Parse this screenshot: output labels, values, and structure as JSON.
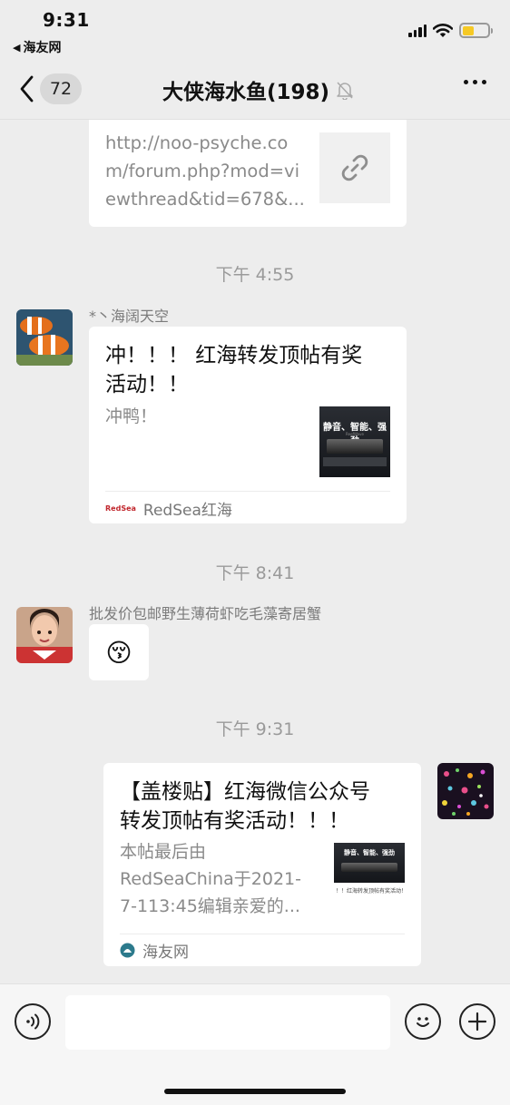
{
  "status_bar": {
    "time": "9:31",
    "back_app": "海友网"
  },
  "nav": {
    "unread_count": "72",
    "title": "大侠海水鱼(198)"
  },
  "messages": {
    "link_card": {
      "url_lines": [
        "http://noo-psyche.co",
        "m/forum.php?mod=vi",
        "ewthread&tid=678&..."
      ]
    },
    "time_1": "下午 4:55",
    "msg_1": {
      "sender": "*丶海阔天空",
      "title_lines": [
        "冲！！！ 红海转发顶帖有奖",
        "活动！！"
      ],
      "desc": "冲鸭！",
      "thumb_text": "静音、智能、强劲",
      "thumb_sub": "ReefWave",
      "source_name": "RedSea红海",
      "source_logo": "RedSea"
    },
    "time_2": "下午 8:41",
    "msg_2": {
      "sender": "批发价包邮野生薄荷虾吃毛藻寄居蟹",
      "emoji": "😚"
    },
    "time_3": "下午 9:31",
    "msg_3": {
      "title_lines": [
        "【盖楼贴】红海微信公众号",
        "转发顶帖有奖活动！！！"
      ],
      "desc_lines": [
        "本帖最后由",
        "RedSeaChina于2021-",
        "7-113:45编辑亲爱的..."
      ],
      "thumb_text": "静音、智能、强劲",
      "thumb_caption": "！！红海转发顶帖有奖活动！",
      "source_name": "海友网"
    }
  },
  "input": {
    "placeholder": ""
  },
  "icons": [
    "signal-icon",
    "wifi-icon",
    "battery-icon",
    "back-chevron-icon",
    "mute-bell-icon",
    "more-icon",
    "link-icon",
    "voice-icon",
    "emoji-icon",
    "plus-icon"
  ],
  "colors": {
    "background": "#ededed",
    "bubble": "#ffffff",
    "meta_text": "#9a9a9a",
    "battery": "#f6c925"
  }
}
